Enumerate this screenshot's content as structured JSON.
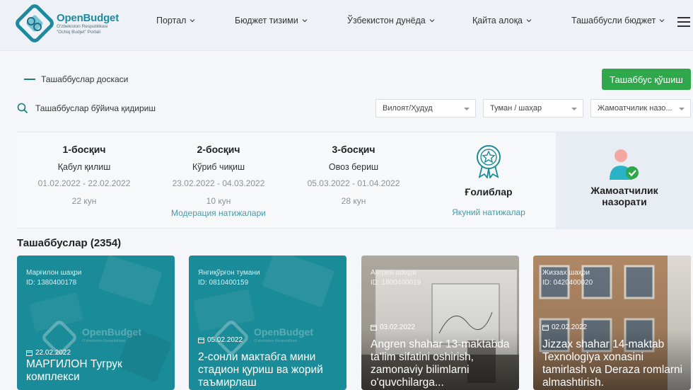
{
  "header": {
    "logo_name": "OpenBudget",
    "logo_sub_line1": "O'zbekiston Respublikasi",
    "logo_sub_line2": "\"Ochiq Budjet\" Portali",
    "nav": [
      "Портал",
      "Бюджет тизими",
      "Ўзбекистон дунёда",
      "Қайта алоқа",
      "Ташаббусли бюджет"
    ]
  },
  "board": {
    "label": "Ташаббуслар доскаси",
    "add_button": "Ташаббус қўшиш"
  },
  "search": {
    "placeholder": "Ташаббуслар бўйича қидириш"
  },
  "filters": {
    "region": "Вилоят/Ҳудуд",
    "district": "Туман / шаҳар",
    "public": "Жамоатчилик назо..."
  },
  "stages": [
    {
      "title": "1-босқич",
      "subtitle": "Қабул қилиш",
      "dates": "01.02.2022 - 22.02.2022",
      "days": "22 кун",
      "link": ""
    },
    {
      "title": "2-босқич",
      "subtitle": "Кўриб чиқиш",
      "dates": "23.02.2022 - 04.03.2022",
      "days": "10 кун",
      "link": "Модерация натижалари"
    },
    {
      "title": "3-босқич",
      "subtitle": "Овоз бериш",
      "dates": "05.03.2022 - 01.04.2022",
      "days": "28 кун",
      "link": ""
    }
  ],
  "winners": {
    "title": "Ғолиблар",
    "link": "Якуний натижалар",
    "icon": "badge-star-icon"
  },
  "public_control": {
    "title_line1": "Жамоатчилик",
    "title_line2": "назорати",
    "icon": "person-check-icon"
  },
  "initiatives": {
    "title": "Ташаббуслар (2354)",
    "cards": [
      {
        "district": "Марғилон шаҳри",
        "id": "ID: 1380400178",
        "date": "22.02.2022",
        "name": "МАРГИЛОН Тугрук комплекси"
      },
      {
        "district": "Янгиқўрғон тумани",
        "id": "ID: 0810400159",
        "date": "05.02.2022",
        "name": "2-сонли мактабга мини стадион қуриш ва жорий таъмирлаш"
      },
      {
        "district": "Ангрен шаҳри",
        "id": "ID: 1800400019",
        "date": "03.02.2022",
        "name": "Angren shahar 13-maktabda ta'lim sifatini oshirish, zamonaviy bilimlarni o'quvchilarga..."
      },
      {
        "district": "Жиззах шаҳри",
        "id": "ID: 0420400020",
        "date": "02.02.2022",
        "name": "Jizzax shahar 14-maktab Texnologiya xonasini tamirlash va Deraza romlarni almashtirish."
      }
    ]
  },
  "colors": {
    "accent_green": "#2ea84a",
    "teal": "#1a8b98",
    "link": "#4a9aa6"
  }
}
